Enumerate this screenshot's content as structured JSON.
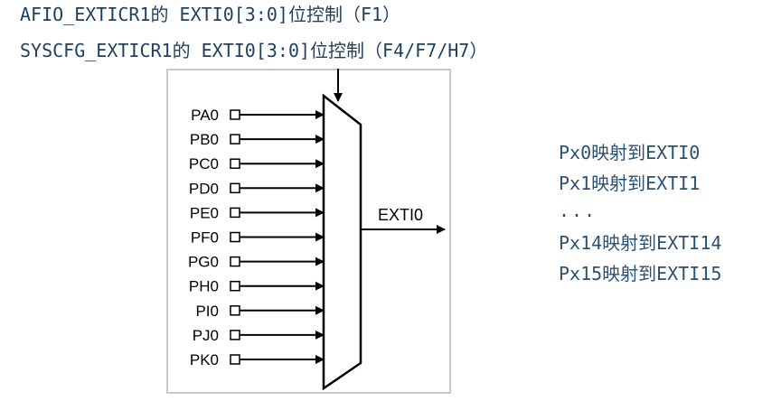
{
  "headings": {
    "afio": "AFIO_EXTICR1的 EXTI0[3:0]位控制（F1）",
    "syscfg": "SYSCFG_EXTICR1的 EXTI0[3:0]位控制（F4/F7/H7）"
  },
  "mux": {
    "inputs": [
      "PA0",
      "PB0",
      "PC0",
      "PD0",
      "PE0",
      "PF0",
      "PG0",
      "PH0",
      "PI0",
      "PJ0",
      "PK0"
    ],
    "output": "EXTI0"
  },
  "mapping": [
    "Px0映射到EXTI0",
    "Px1映射到EXTI1",
    "...",
    "Px14映射到EXTI14",
    "Px15映射到EXTI15"
  ],
  "colors": {
    "heading_text": "#1f3f5b",
    "mapping_text": "#2a5176",
    "diagram_line": "#000000",
    "diagram_border": "#c9c9c9"
  }
}
